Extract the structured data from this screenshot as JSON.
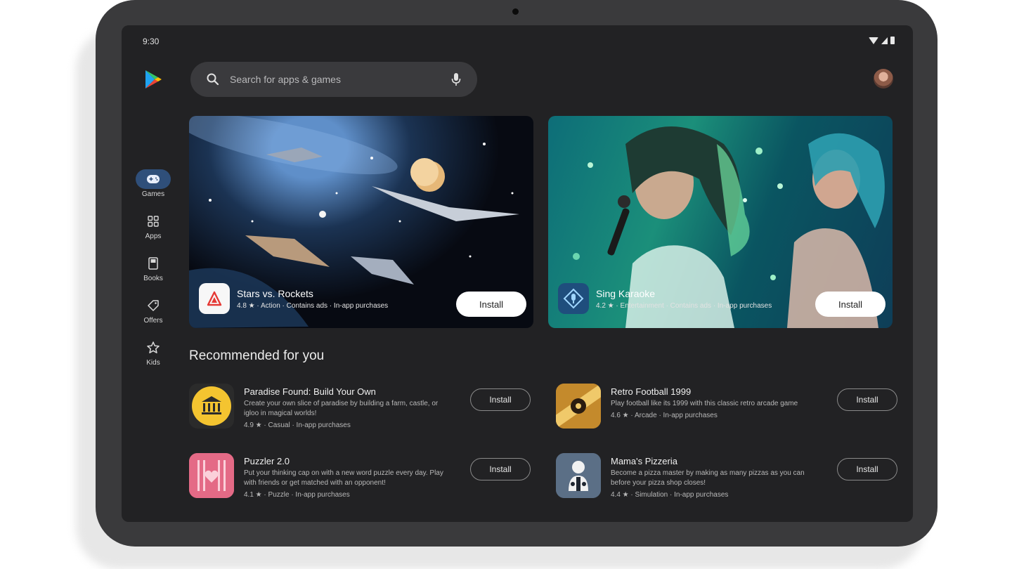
{
  "status": {
    "time": "9:30"
  },
  "search": {
    "placeholder": "Search for apps & games"
  },
  "rail": {
    "items": [
      {
        "label": "Games",
        "active": true
      },
      {
        "label": "Apps"
      },
      {
        "label": "Books"
      },
      {
        "label": "Offers"
      },
      {
        "label": "Kids"
      }
    ]
  },
  "featured": [
    {
      "title": "Stars vs. Rockets",
      "meta": "4.8 ★ · Action · Contains ads · In-app purchases",
      "install": "Install"
    },
    {
      "title": "Sing Karaoke",
      "meta": "4.2 ★ · Entertainment · Contains ads · In-app purchases",
      "install": "Install"
    }
  ],
  "recommended": {
    "title": "Recommended for you",
    "items": [
      {
        "title": "Paradise Found: Build Your Own",
        "desc": "Create your own slice of paradise by building a farm, castle, or igloo in magical worlds!",
        "meta": "4.9 ★ · Casual · In-app purchases",
        "install": "Install"
      },
      {
        "title": "Retro Football 1999",
        "desc": "Play football like its 1999 with this classic retro arcade game",
        "meta": "4.6 ★ · Arcade · In-app purchases",
        "install": "Install"
      },
      {
        "title": "Puzzler 2.0",
        "desc": "Put your thinking cap on with a new word puzzle every day. Play with friends or get matched with an opponent!",
        "meta": "4.1 ★ · Puzzle · In-app purchases",
        "install": "Install"
      },
      {
        "title": "Mama's Pizzeria",
        "desc": "Become a pizza master by making as many pizzas as you can before your pizza shop closes!",
        "meta": "4.4 ★ · Simulation · In-app purchases",
        "install": "Install"
      }
    ]
  },
  "colors": {
    "screen_bg": "#222224",
    "rail_active": "#2f4f7a",
    "device_frame": "#3a3a3c"
  }
}
